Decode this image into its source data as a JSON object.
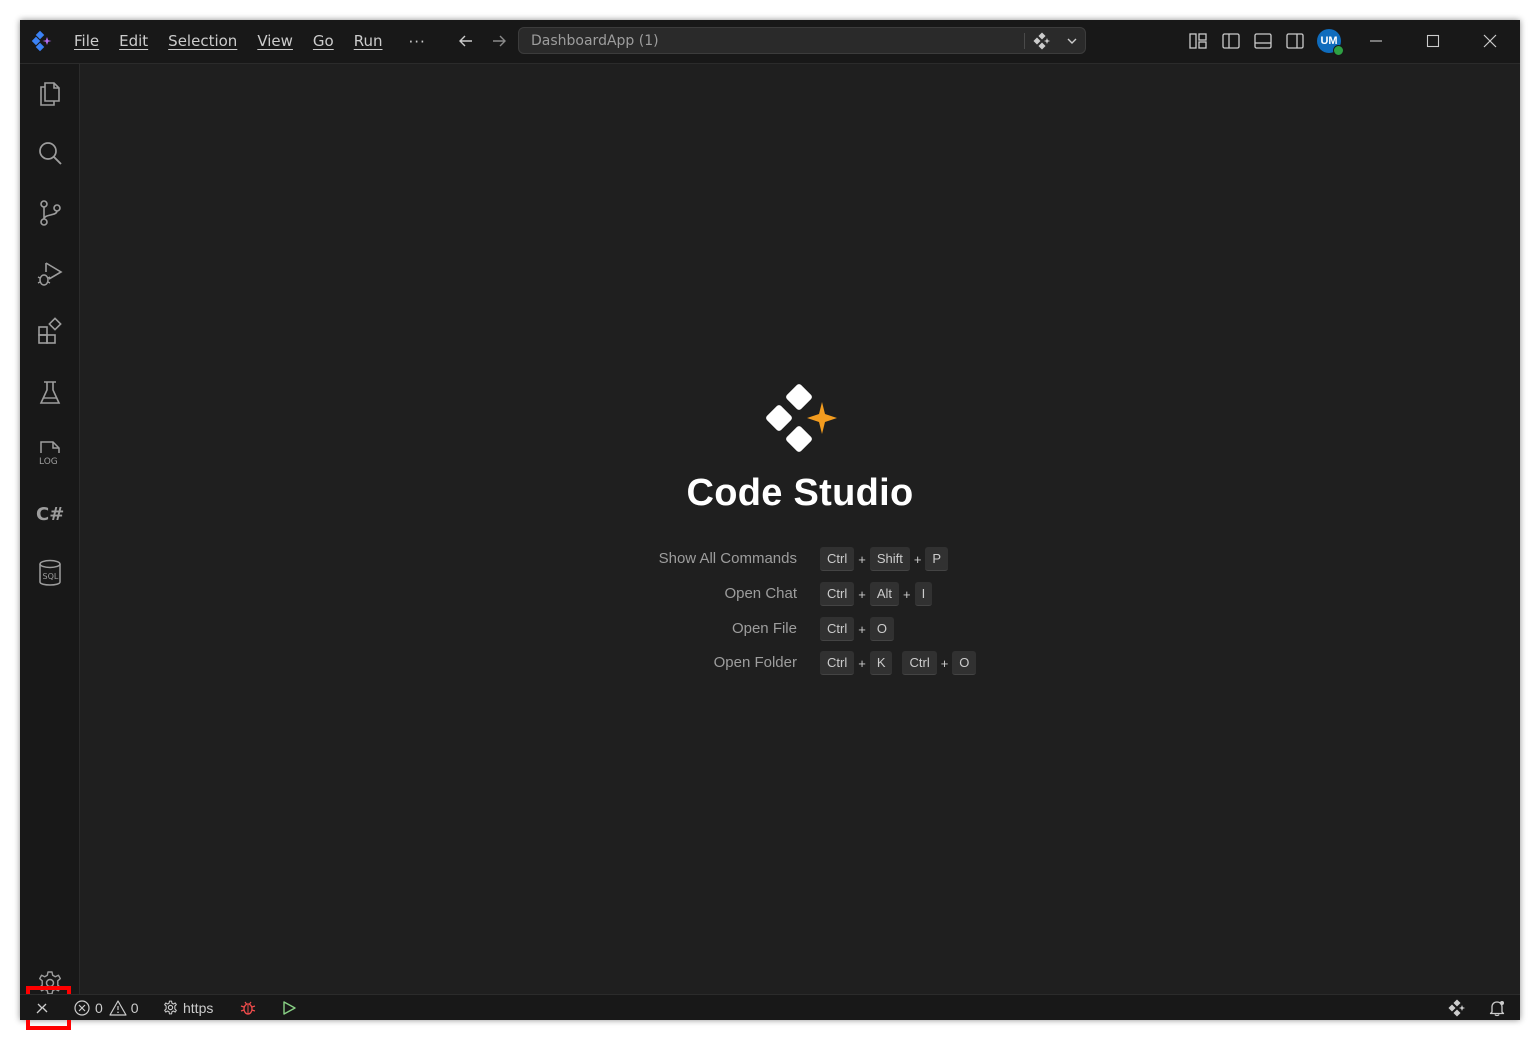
{
  "menu": {
    "items": [
      "File",
      "Edit",
      "Selection",
      "View",
      "Go",
      "Run"
    ],
    "more": "···"
  },
  "command_center": {
    "text": "DashboardApp (1)"
  },
  "account": {
    "initials": "UM"
  },
  "welcome": {
    "title": "Code Studio",
    "shortcuts": [
      {
        "label": "Show All Commands",
        "keys": [
          [
            "Ctrl",
            "Shift",
            "P"
          ]
        ]
      },
      {
        "label": "Open Chat",
        "keys": [
          [
            "Ctrl",
            "Alt",
            "I"
          ]
        ]
      },
      {
        "label": "Open File",
        "keys": [
          [
            "Ctrl",
            "O"
          ]
        ]
      },
      {
        "label": "Open Folder",
        "keys": [
          [
            "Ctrl",
            "K"
          ],
          [
            "Ctrl",
            "O"
          ]
        ]
      }
    ]
  },
  "statusbar": {
    "errors": "0",
    "warnings": "0",
    "profile": "https"
  },
  "activity_icons": [
    "explorer-icon",
    "search-icon",
    "source-control-icon",
    "run-debug-icon",
    "extensions-icon",
    "testing-icon",
    "log-icon",
    "csharp-icon",
    "sql-icon",
    "settings-gear-icon"
  ],
  "colors": {
    "accent_avatar": "#0f6cbd",
    "online_dot": "#2ea043",
    "highlight": "#ff0000",
    "logo_star": "#f39c1f",
    "debug_icon": "#f14c4c",
    "run_icon": "#89d185"
  }
}
